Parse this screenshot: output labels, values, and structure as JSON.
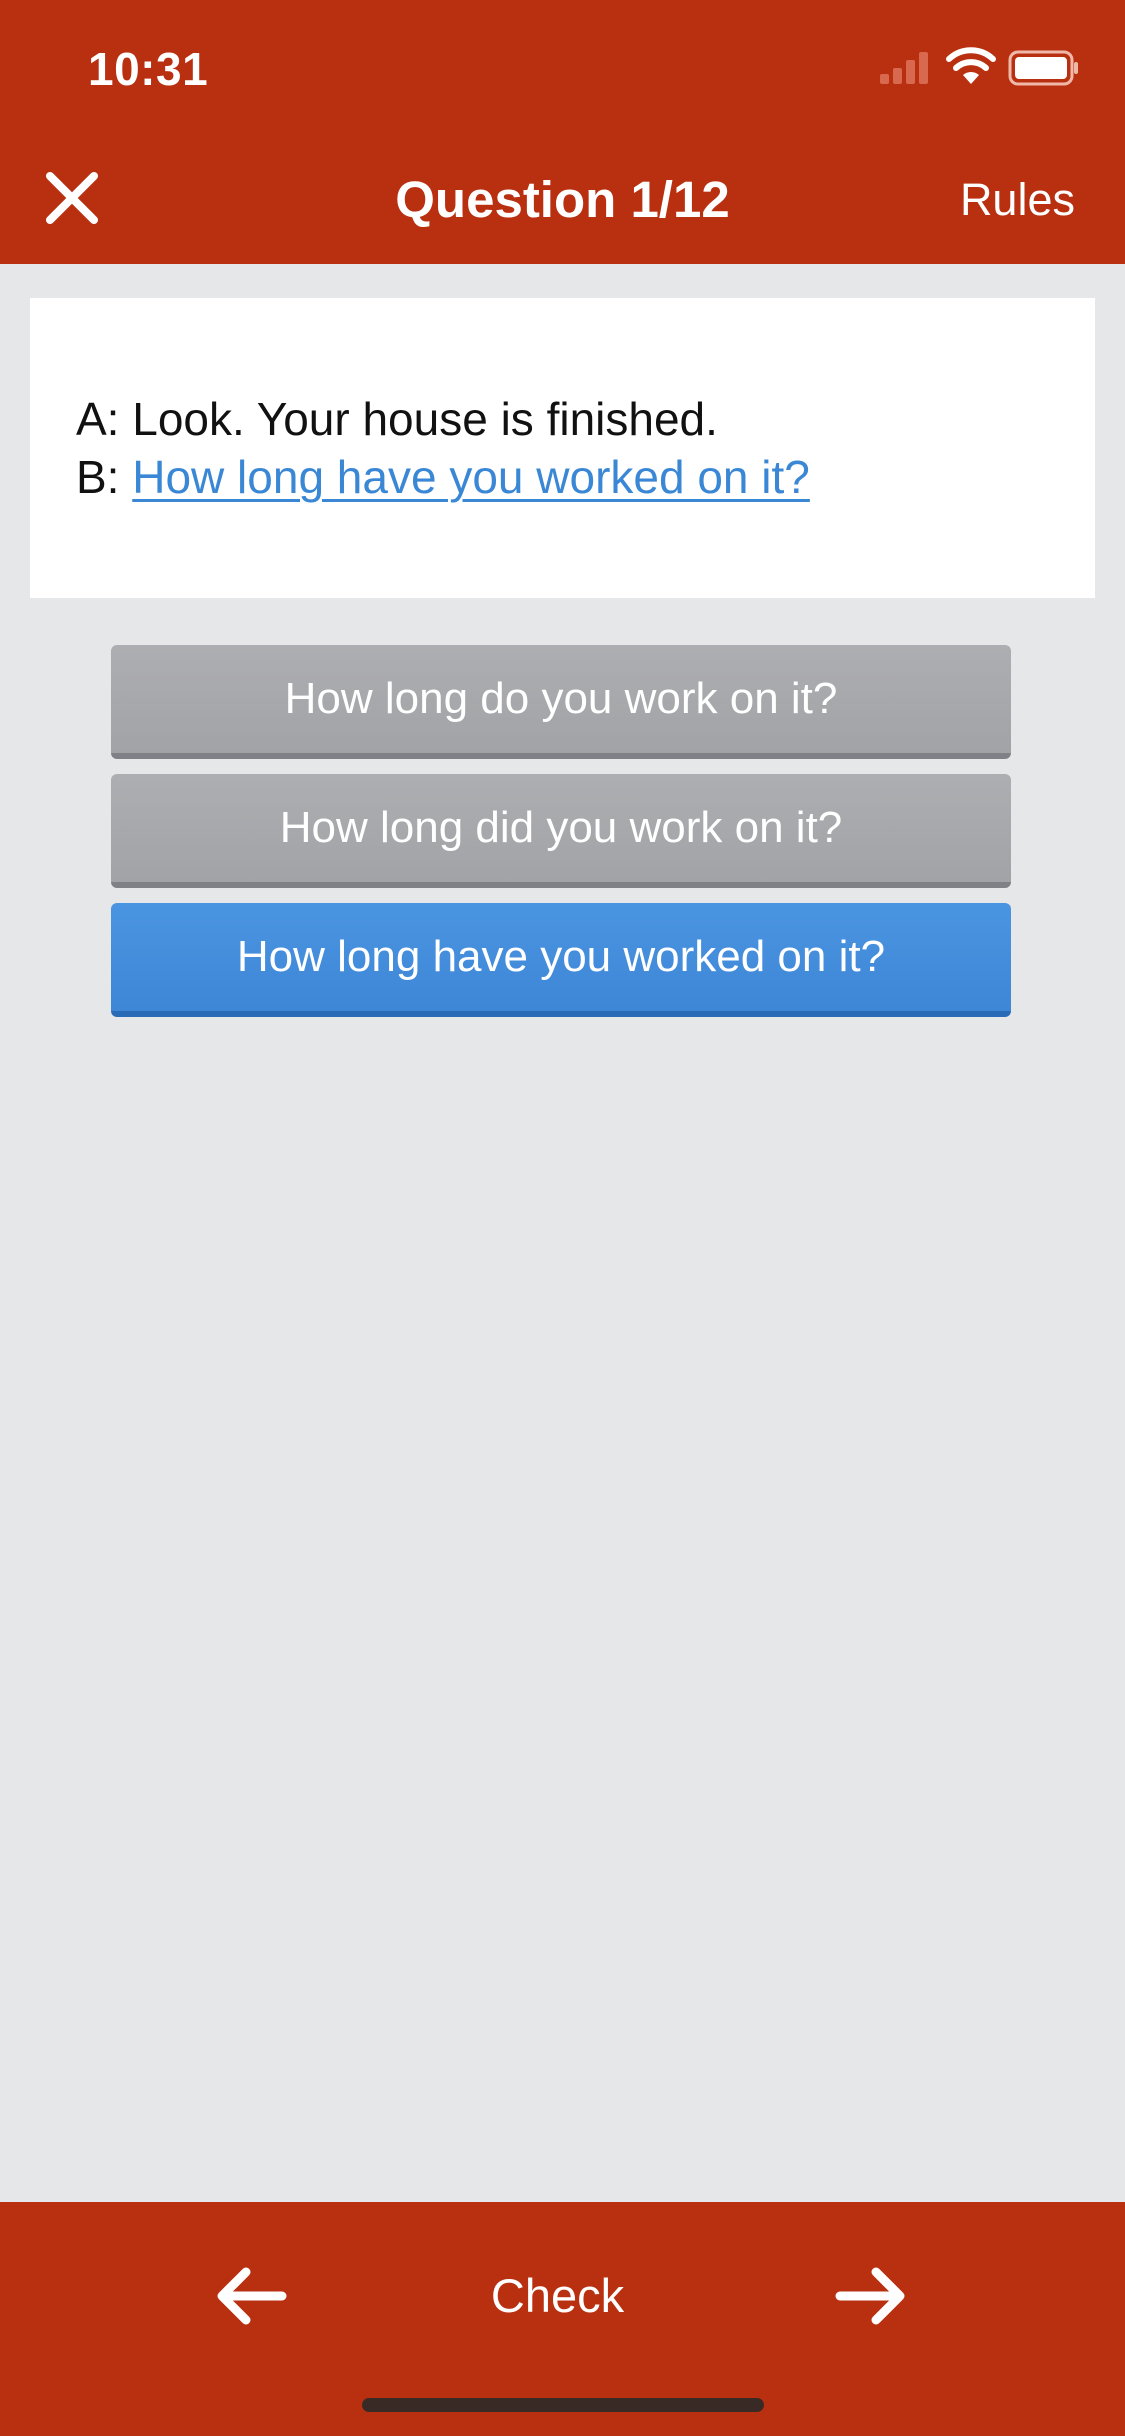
{
  "status_bar": {
    "time": "10:31"
  },
  "header": {
    "close_icon": "close-x-icon",
    "title": "Question 1/12",
    "rules_label": "Rules"
  },
  "question": {
    "line_a_prefix": "A:",
    "line_a_text": "Look. Your house is finished.",
    "line_b_prefix": "B:",
    "line_b_answer": "How long have you worked on it?"
  },
  "options": [
    {
      "label": "How long do you work on it?",
      "selected": false
    },
    {
      "label": "How long did you work on it?",
      "selected": false
    },
    {
      "label": "How long have you worked on it?",
      "selected": true
    }
  ],
  "footer": {
    "prev_icon": "arrow-left-icon",
    "check_label": "Check",
    "next_icon": "arrow-right-icon"
  },
  "colors": {
    "brand": "#b93011",
    "background": "#e6e7e9",
    "selected_option": "#4090dd",
    "unselected_option": "#a7a8ab",
    "link": "#3a87d5"
  }
}
